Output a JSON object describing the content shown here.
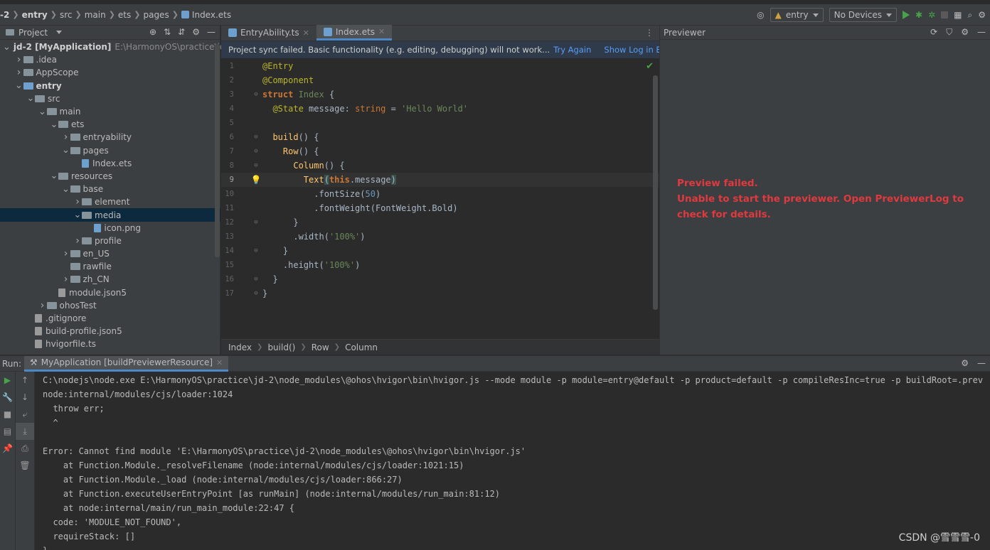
{
  "breadcrumb": [
    "-2",
    "entry",
    "src",
    "main",
    "ets",
    "pages",
    "Index.ets"
  ],
  "toolbar": {
    "module_combo": "entry",
    "devices_combo": "No Devices"
  },
  "project_panel": {
    "title": "Project",
    "tree": [
      {
        "label": "jd-2 [MyApplication]",
        "path": "E:\\HarmonyOS\\practice\\jd-",
        "indent": 0,
        "chev": "v",
        "kind": "folder-blue",
        "bold": true
      },
      {
        "label": ".idea",
        "indent": 1,
        "chev": ">",
        "kind": "folder"
      },
      {
        "label": "AppScope",
        "indent": 1,
        "chev": ">",
        "kind": "folder"
      },
      {
        "label": "entry",
        "indent": 1,
        "chev": "v",
        "kind": "folder-blue",
        "bold": true
      },
      {
        "label": "src",
        "indent": 2,
        "chev": "v",
        "kind": "folder"
      },
      {
        "label": "main",
        "indent": 3,
        "chev": "v",
        "kind": "folder"
      },
      {
        "label": "ets",
        "indent": 4,
        "chev": "v",
        "kind": "folder"
      },
      {
        "label": "entryability",
        "indent": 5,
        "chev": ">",
        "kind": "folder"
      },
      {
        "label": "pages",
        "indent": 5,
        "chev": "v",
        "kind": "folder"
      },
      {
        "label": "Index.ets",
        "indent": 6,
        "chev": "",
        "kind": "file"
      },
      {
        "label": "resources",
        "indent": 4,
        "chev": "v",
        "kind": "folder"
      },
      {
        "label": "base",
        "indent": 5,
        "chev": "v",
        "kind": "folder"
      },
      {
        "label": "element",
        "indent": 6,
        "chev": ">",
        "kind": "folder"
      },
      {
        "label": "media",
        "indent": 6,
        "chev": "v",
        "kind": "folder",
        "selected": true
      },
      {
        "label": "icon.png",
        "indent": 7,
        "chev": "",
        "kind": "file"
      },
      {
        "label": "profile",
        "indent": 6,
        "chev": ">",
        "kind": "folder"
      },
      {
        "label": "en_US",
        "indent": 5,
        "chev": ">",
        "kind": "folder"
      },
      {
        "label": "rawfile",
        "indent": 5,
        "chev": "",
        "kind": "folder"
      },
      {
        "label": "zh_CN",
        "indent": 5,
        "chev": ">",
        "kind": "folder"
      },
      {
        "label": "module.json5",
        "indent": 4,
        "chev": "",
        "kind": "file-gray"
      },
      {
        "label": "ohosTest",
        "indent": 3,
        "chev": ">",
        "kind": "folder"
      },
      {
        "label": ".gitignore",
        "indent": 2,
        "chev": "",
        "kind": "file-gray"
      },
      {
        "label": "build-profile.json5",
        "indent": 2,
        "chev": "",
        "kind": "file-gray"
      },
      {
        "label": "hvigorfile.ts",
        "indent": 2,
        "chev": "",
        "kind": "file-gray"
      }
    ]
  },
  "editor": {
    "tabs": [
      {
        "label": "EntryAbility.ts",
        "active": false
      },
      {
        "label": "Index.ets",
        "active": true
      }
    ],
    "banner": {
      "message": "Project sync failed. Basic functionality (e.g. editing, debugging) will not work...",
      "try_again": "Try Again",
      "show_log": "Show Log in Explorer"
    },
    "breadcrumb": [
      "Index",
      "build()",
      "Row",
      "Column"
    ]
  },
  "previewer": {
    "title": "Previewer",
    "error_title": "Preview failed.",
    "error_detail": "Unable to start the previewer. Open PreviewerLog to check for details."
  },
  "run_panel": {
    "label": "Run:",
    "tab": "MyApplication [buildPreviewerResource]",
    "lines": [
      "C:\\nodejs\\node.exe E:\\HarmonyOS\\practice\\jd-2\\node_modules\\@ohos\\hvigor\\bin\\hvigor.js --mode module -p module=entry@default -p product=default -p compileResInc=true -p buildRoot=.prev",
      "node:internal/modules/cjs/loader:1024",
      "  throw err;",
      "  ^",
      "",
      "Error: Cannot find module 'E:\\HarmonyOS\\practice\\jd-2\\node_modules\\@ohos\\hvigor\\bin\\hvigor.js'",
      "    at Function.Module._resolveFilename (node:internal/modules/cjs/loader:1021:15)",
      "    at Function.Module._load (node:internal/modules/cjs/loader:866:27)",
      "    at Function.executeUserEntryPoint [as runMain] (node:internal/modules/run_main:81:12)",
      "    at node:internal/main/run_main_module:22:47 {",
      "  code: 'MODULE_NOT_FOUND',",
      "  requireStack: []",
      "}"
    ]
  },
  "watermark": "CSDN @雪雪雪-0"
}
